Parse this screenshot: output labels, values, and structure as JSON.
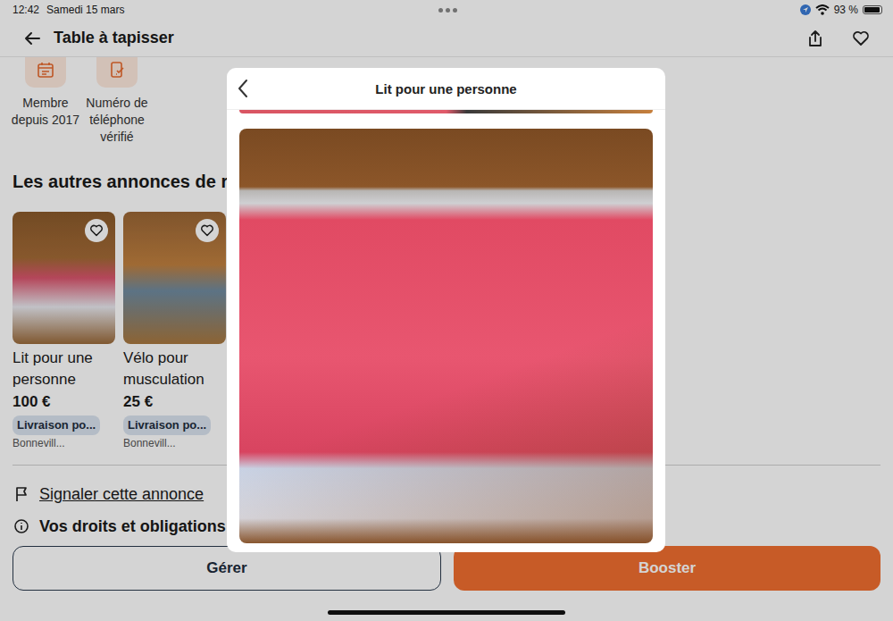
{
  "status_bar": {
    "time": "12:42",
    "date": "Samedi 15 mars",
    "battery": "93 %",
    "battery_level": 0.93
  },
  "header": {
    "title": "Table à tapisser"
  },
  "seller_badges": [
    {
      "label": "Membre depuis 2017",
      "kind": "calendar"
    },
    {
      "label": "Numéro de téléphone vérifié",
      "kind": "phone"
    }
  ],
  "section_title": "Les autres annonces de r.",
  "listings": [
    {
      "title": "Lit pour une personne",
      "price": "100 €",
      "delivery": "Livraison po...",
      "location": "Bonnevill...",
      "favorite": false
    },
    {
      "title": "Vélo pour musculation",
      "price": "25 €",
      "delivery": "Livraison po...",
      "location": "Bonnevill...",
      "favorite": false
    }
  ],
  "report_link": "Signaler cette annonce",
  "rights_link": "Vos droits et obligations",
  "buttons": [
    {
      "label": "Gérer",
      "kind": "outline"
    },
    {
      "label": "Booster",
      "kind": "primary"
    }
  ],
  "modal": {
    "title": "Lit pour une personne"
  }
}
